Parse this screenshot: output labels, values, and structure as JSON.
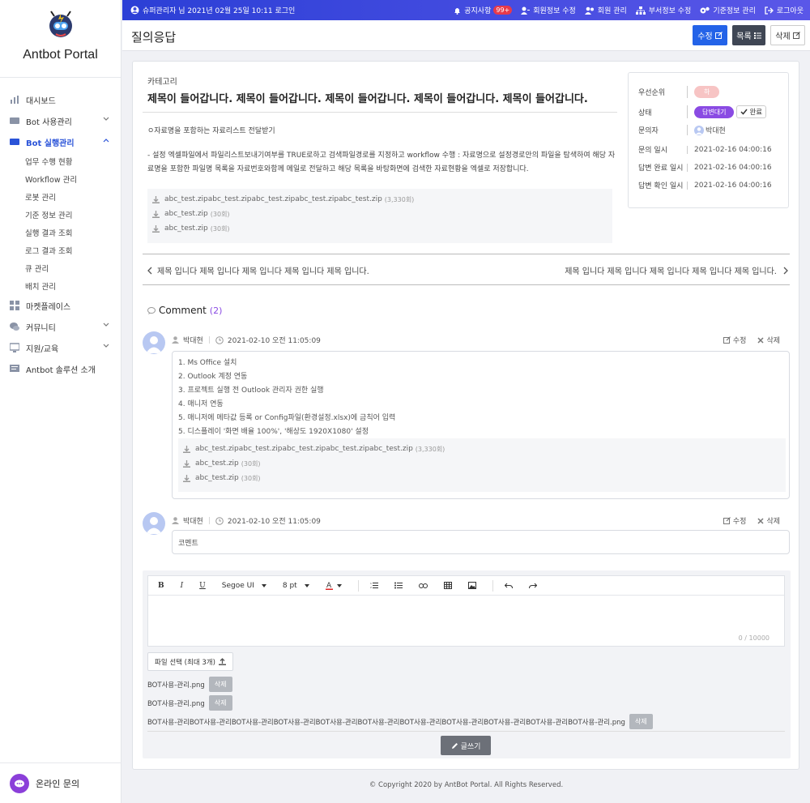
{
  "app": {
    "title": "Antbot Portal"
  },
  "sidebar": {
    "items": [
      {
        "label": "대시보드",
        "icon": "chart-icon"
      },
      {
        "label": "Bot 사용관리",
        "icon": "card-icon"
      },
      {
        "label": "Bot 실행관리",
        "icon": "card-icon",
        "active": true
      },
      {
        "label": "마켓플레이스",
        "icon": "grid-icon"
      },
      {
        "label": "커뮤니티",
        "icon": "chat-icon"
      },
      {
        "label": "지원/교육",
        "icon": "screen-icon"
      },
      {
        "label": "Antbot 솔루션 소개",
        "icon": "doc-icon"
      }
    ],
    "subitems": [
      "업무 수행 현황",
      "Workflow 관리",
      "로봇 관리",
      "기준 정보 관리",
      "실행 결과 조회",
      "로그 결과 조회",
      "큐 관리",
      "배치 관리"
    ],
    "online": "온라인 문의"
  },
  "topbar": {
    "user": "슈퍼관리자",
    "login": "님 2021년 02월 25일 10:11 로그인",
    "notice": "공지사항",
    "notice_count": "99+",
    "links": [
      "회원정보 수정",
      "회원 관리",
      "부서정보 수정",
      "기준정보 관리",
      "로그아웃"
    ]
  },
  "page": {
    "title": "질의응답",
    "edit": "수정",
    "list": "목록",
    "delete": "삭제"
  },
  "question": {
    "category": "카테고리",
    "title": "제목이 들어갑니다. 제목이 들어갑니다. 제목이 들어갑니다. 제목이 들어갑니다. 제목이 들어갑니다.",
    "line1": "ㅇ자료명을 포함하는 자료리스트 전달받기",
    "line2": "- 설정 엑셀파일에서 파일리스트보내기여부를 TRUE로하고 검색파일경로를 지정하고 workflow 수행 : 자료명으로 설정경로안의 파일을 탐색하여 해당 자료명을 포함한 파일명 목록을 자료번호와함께 메일로 전달하고 해당 목록을 바탕화면에 검색한 자료현황을 엑셀로 저장합니다.",
    "files": [
      {
        "name": "abc_test.zipabc_test.zipabc_test.zipabc_test.zipabc_test.zip",
        "size": "(3,330회)"
      },
      {
        "name": "abc_test.zip",
        "size": "(30회)"
      },
      {
        "name": "abc_test.zip",
        "size": "(30회)"
      }
    ]
  },
  "info": {
    "priority_label": "우선순위",
    "priority": "하",
    "status_label": "상태",
    "status": "답변대기",
    "done": "완료",
    "asker_label": "문의자",
    "asker": "박대현",
    "asked_label": "문의 일시",
    "asked": "2021-02-16 04:00:16",
    "answered_label": "답변 완료 일시",
    "answered": "2021-02-16 04:00:16",
    "confirmed_label": "답변 확인 일시",
    "confirmed": "2021-02-16 04:00:16"
  },
  "nav": {
    "prev": "제목 입니다 제목 입니다 제목 입니다 제목 입니다 제목 입니다.",
    "next": "제목 입니다 제목 입니다 제목 입니다 제목 입니다 제목 입니다."
  },
  "comments": {
    "heading": "Comment",
    "count": "(2)",
    "edit": "수정",
    "delete": "삭제",
    "c1": {
      "author": "박대현",
      "date": "2021-02-10 오전 11:05:09",
      "lines": [
        "1. Ms Office 설치",
        "2. Outlook 계정 연동",
        "3. 프로젝트 실행 전 Outlook 관리자 권한 실행",
        "4. 매니저 연동",
        "5. 매니저에 메타값 등록 or Config파일(환경설정.xlsx)에 금칙어 입력",
        "5. 디스플레이 '화면 배율 100%', '해상도 1920X1080' 설정"
      ],
      "files": [
        {
          "name": "abc_test.zipabc_test.zipabc_test.zipabc_test.zipabc_test.zip",
          "size": "(3,330회)"
        },
        {
          "name": "abc_test.zip",
          "size": "(30회)"
        },
        {
          "name": "abc_test.zip",
          "size": "(30회)"
        }
      ]
    },
    "c2": {
      "author": "박대현",
      "date": "2021-02-10 오전 11:05:09",
      "text": "코멘트"
    }
  },
  "editor": {
    "font": "Segoe UI",
    "size": "8 pt",
    "counter": "0 / 10000",
    "file_select": "파일 선택 (최대 3개)",
    "attachments": [
      "BOT사용-관리.png",
      "BOT사용-관리.png",
      "BOT사용-관리BOT사용-관리BOT사용-관리BOT사용-관리BOT사용-관리BOT사용-관리BOT사용-관리BOT사용-관리BOT사용-관리BOT사용-관리BOT사용-관리.png"
    ],
    "remove": "삭제",
    "submit": "글쓰기"
  },
  "footer": {
    "copyright": "© Copyright 2020 by AntBot Portal. All Rights Reserved."
  }
}
